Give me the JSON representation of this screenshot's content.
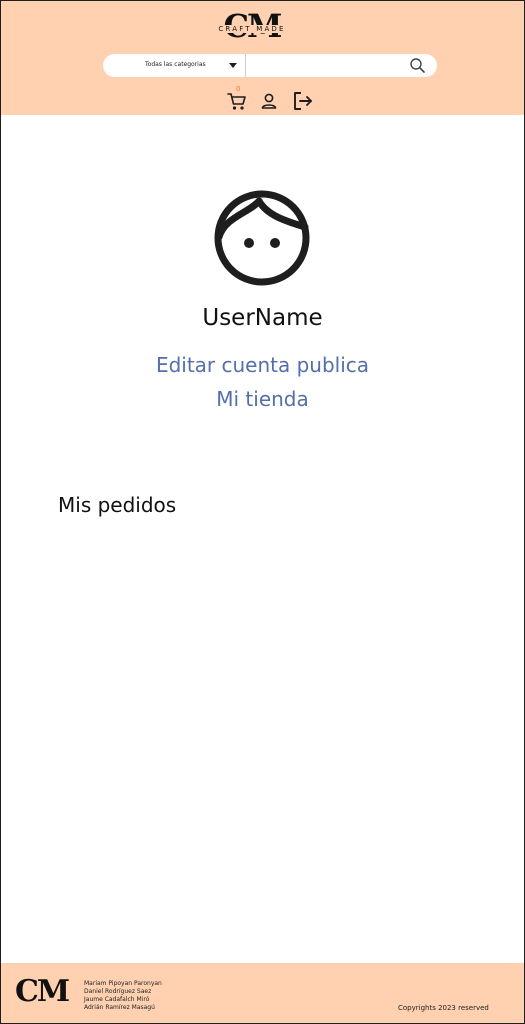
{
  "brand": {
    "logo_letters": "CM",
    "tagline": "CRAFT MADE"
  },
  "search": {
    "category_selected": "Todas las categorias",
    "value": "",
    "placeholder": ""
  },
  "header_icons": {
    "cart_count": "0",
    "icons": [
      "cart-icon",
      "user-icon",
      "logout-icon"
    ]
  },
  "profile": {
    "username": "UserName",
    "edit_link": "Editar cuenta publica",
    "store_link": "Mi tienda"
  },
  "orders": {
    "title": "Mis pedidos"
  },
  "footer": {
    "logo_letters": "CM",
    "authors": [
      "Mariam Pipoyan Paronyan",
      "Daniel Rodríguez Saez",
      "Jaume Cadafalch Miró",
      "Adrián Ramírez Masagú"
    ],
    "copyright": "Copyrights 2023 reserved"
  },
  "colors": {
    "header_bg": "#ffd1b1",
    "link": "#5470a8",
    "text": "#111111"
  }
}
